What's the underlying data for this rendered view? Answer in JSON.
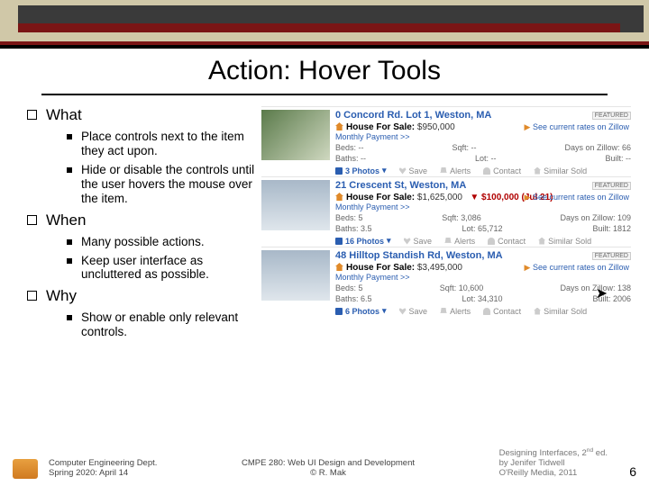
{
  "title": "Action: Hover Tools",
  "sections": {
    "what": {
      "heading": "What",
      "items": [
        "Place controls next to the item they act upon.",
        "Hide or disable the controls until the user hovers the mouse over the item."
      ]
    },
    "when": {
      "heading": "When",
      "items": [
        "Many possible actions.",
        "Keep user interface as uncluttered as possible."
      ]
    },
    "why": {
      "heading": "Why",
      "items": [
        "Show or enable only relevant controls."
      ]
    }
  },
  "listings": [
    {
      "address": "0 Concord Rd. Lot 1, Weston, MA",
      "badge": "FEATURED",
      "price_label": "House For Sale:",
      "price": "$950,000",
      "monthly": "Monthly Payment >>",
      "rates": "See current rates on Zillow",
      "beds": "Beds: --",
      "sqft": "Sqft: --",
      "days": "Days on Zillow: 66",
      "baths": "Baths: --",
      "lot": "Lot: --",
      "built": "Built: --",
      "photos": "3 Photos",
      "tools": [
        "Save",
        "Alerts",
        "Contact",
        "Similar Sold"
      ]
    },
    {
      "address": "21 Crescent St, Weston, MA",
      "badge": "FEATURED",
      "price_label": "House For Sale:",
      "price": "$1,625,000",
      "drop": "$100,000 (Jul 21)",
      "monthly": "Monthly Payment >>",
      "rates": "See current rates on Zillow",
      "beds": "Beds: 5",
      "sqft": "Sqft: 3,086",
      "days": "Days on Zillow: 109",
      "baths": "Baths: 3.5",
      "lot": "Lot: 65,712",
      "built": "Built: 1812",
      "photos": "16 Photos",
      "tools": [
        "Save",
        "Alerts",
        "Contact",
        "Similar Sold"
      ]
    },
    {
      "address": "48 Hilltop Standish Rd, Weston, MA",
      "badge": "FEATURED",
      "price_label": "House For Sale:",
      "price": "$3,495,000",
      "monthly": "Monthly Payment >>",
      "rates": "See current rates on Zillow",
      "beds": "Beds: 5",
      "sqft": "Sqft: 10,600",
      "days": "Days on Zillow: 138",
      "baths": "Baths: 6.5",
      "lot": "Lot: 34,310",
      "built": "Built: 2006",
      "photos": "6 Photos",
      "tools": [
        "Save",
        "Alerts",
        "Contact",
        "Similar Sold"
      ]
    }
  ],
  "footer": {
    "left1": "Computer Engineering Dept.",
    "left2": "Spring 2020: April 14",
    "center1": "CMPE 280: Web UI Design and Development",
    "center2": "© R. Mak",
    "credits1_a": "Designing Interfaces, 2",
    "credits1_b": " ed.",
    "credits2": "by Jenifer Tidwell",
    "credits3": "O'Reilly Media, 2011",
    "page": "6"
  }
}
